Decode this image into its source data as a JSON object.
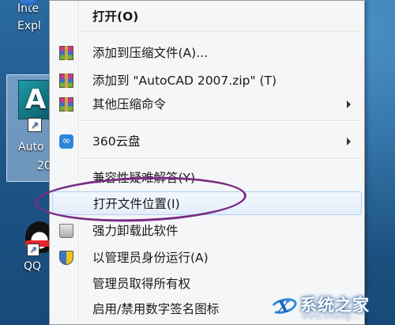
{
  "desktop": {
    "ie_label_1": "Inte",
    "ie_label_2": "Expl",
    "autocad_logo": "A",
    "autocad_label_1": "Auto",
    "autocad_label_2": "20",
    "qq_label": "QQ"
  },
  "menu": {
    "items": [
      {
        "label": "打开(O)",
        "icon": "none"
      },
      {
        "label": "添加到压缩文件(A)...",
        "icon": "winrar-icon"
      },
      {
        "label": "添加到 \"AutoCAD 2007.zip\" (T)",
        "icon": "winrar-icon"
      },
      {
        "label": "其他压缩命令",
        "icon": "winrar-icon",
        "submenu": true
      },
      {
        "label": "360云盘",
        "icon": "cloud-360-icon",
        "submenu": true
      },
      {
        "label": "兼容性疑难解答(Y)",
        "icon": "none"
      },
      {
        "label": "打开文件位置(I)",
        "icon": "none",
        "highlighted": true
      },
      {
        "label": "强力卸载此软件",
        "icon": "trash-icon"
      },
      {
        "label": "以管理员身份运行(A)",
        "icon": "uac-shield-icon"
      },
      {
        "label": "管理员取得所有权",
        "icon": "none"
      },
      {
        "label": "启用/禁用数字签名图标",
        "icon": "none"
      }
    ]
  },
  "watermark": {
    "logo_letter": "X",
    "text": "系统之家",
    "url": "www.xitong..."
  },
  "colors": {
    "menu_bg": "#f5f6f7",
    "highlight_border": "#aecff7",
    "annotation_ellipse": "#7b2c84"
  }
}
